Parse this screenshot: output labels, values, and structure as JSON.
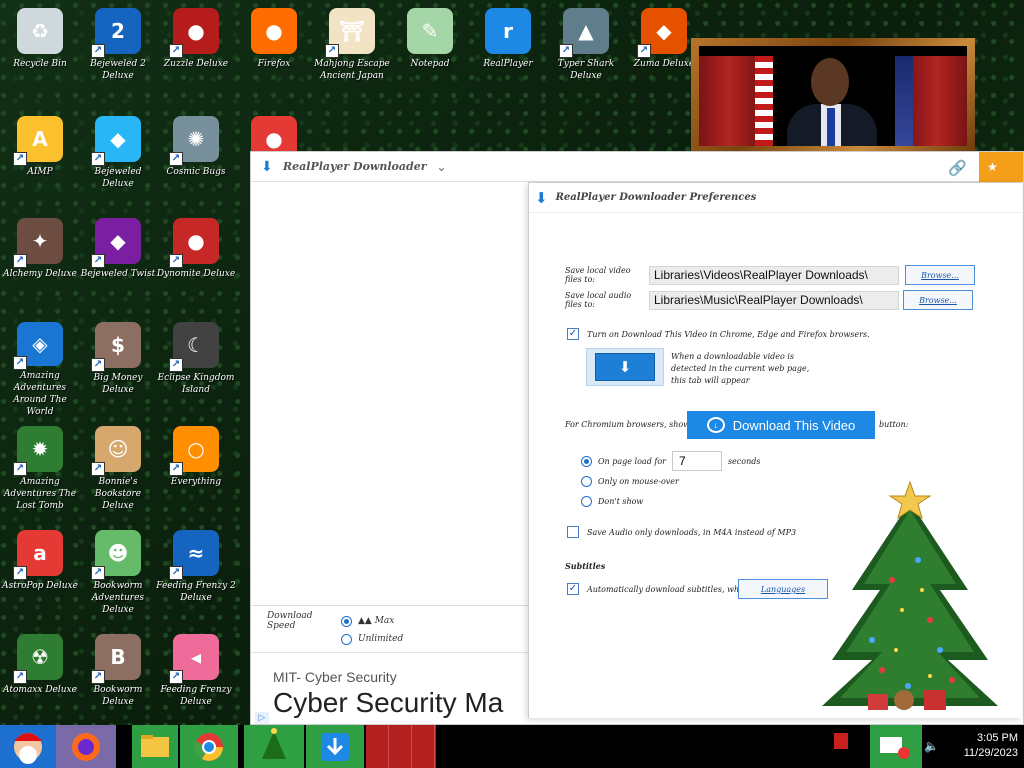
{
  "desktop": {
    "icons": [
      {
        "id": "recycle",
        "label": "Recycle Bin"
      },
      {
        "id": "bejeweled2",
        "label": "Bejeweled 2 Deluxe"
      },
      {
        "id": "zuzzle",
        "label": "Zuzzle Deluxe"
      },
      {
        "id": "firefox",
        "label": "Firefox"
      },
      {
        "id": "mahjong",
        "label": "Mahjong Escape Ancient Japan"
      },
      {
        "id": "notepad",
        "label": "Notepad"
      },
      {
        "id": "realplayer",
        "label": "RealPlayer"
      },
      {
        "id": "typershark",
        "label": "Typer Shark Deluxe"
      },
      {
        "id": "zuma",
        "label": "Zuma Deluxe"
      },
      {
        "id": "aimp",
        "label": "AIMP"
      },
      {
        "id": "bejeweled",
        "label": "Bejeweled Deluxe"
      },
      {
        "id": "cosmicbugs",
        "label": "Cosmic Bugs"
      },
      {
        "id": "chrome",
        "label": ""
      },
      {
        "id": "alchemy",
        "label": "Alchemy Deluxe"
      },
      {
        "id": "bejtwist",
        "label": "Bejeweled Twist"
      },
      {
        "id": "dynomite",
        "label": "Dynomite Deluxe"
      },
      {
        "id": "aroundworld",
        "label": "Amazing Adventures Around The World"
      },
      {
        "id": "bigmoney",
        "label": "Big Money Deluxe"
      },
      {
        "id": "eclipse",
        "label": "Eclipse Kingdom Island"
      },
      {
        "id": "losttomb",
        "label": "Amazing Adventures The Lost Tomb"
      },
      {
        "id": "bonnie",
        "label": "Bonnie's Bookstore Deluxe"
      },
      {
        "id": "everything",
        "label": "Everything"
      },
      {
        "id": "astropop",
        "label": "AstroPop Deluxe"
      },
      {
        "id": "bookworm-adv",
        "label": "Bookworm Adventures Deluxe"
      },
      {
        "id": "feedingfrenzy2",
        "label": "Feeding Frenzy 2 Deluxe"
      },
      {
        "id": "atomaxx",
        "label": "Atomaxx Deluxe"
      },
      {
        "id": "bookworm",
        "label": "Bookworm Deluxe"
      },
      {
        "id": "feedingfrenzy",
        "label": "Feeding Frenzy Deluxe"
      }
    ]
  },
  "rp_window": {
    "title": "RealPlayer Downloader",
    "download_speed_label": "Download Speed",
    "speed_opt1": "▲▲ Max",
    "speed_opt2": "Unlimited",
    "ad_small": "MIT- Cyber Security",
    "ad_big": "Cyber Security Ma"
  },
  "prefs": {
    "title": "RealPlayer Downloader Preferences",
    "video_label": "Save local video files to:",
    "video_path": "Libraries\\Videos\\RealPlayer Downloads\\",
    "audio_label": "Save local audio files to:",
    "audio_path": "Libraries\\Music\\RealPlayer Downloads\\",
    "browse": "Browse...",
    "dtv_check_label": "Turn on Download This Video in Chrome, Edge and Firefox browsers.",
    "preview_desc": "When a downloadable video is detected in the current web page, this tab will appear",
    "browsers_label": "For Chromium browsers, show the",
    "dtv_button": "Download This Video",
    "button_suffix": "button:",
    "opt_hover_a": "On page load for",
    "seconds_value": "7",
    "opt_hover_b": "seconds",
    "opt_mouse": "Only on mouse-over",
    "opt_dont": "Don't show",
    "save_audio_label": "Save Audio only downloads, in M4A instead of MP3",
    "subtitles_heading": "Subtitles",
    "subtitles_label": "Automatically download subtitles, when available",
    "languages": "Languages"
  },
  "taskbar": {
    "time": "3:05 PM",
    "date": "11/29/2023"
  },
  "colors": {
    "accent": "#1e88e5",
    "orange": "#f59e1a",
    "taskbar_green": "#2ea043"
  }
}
